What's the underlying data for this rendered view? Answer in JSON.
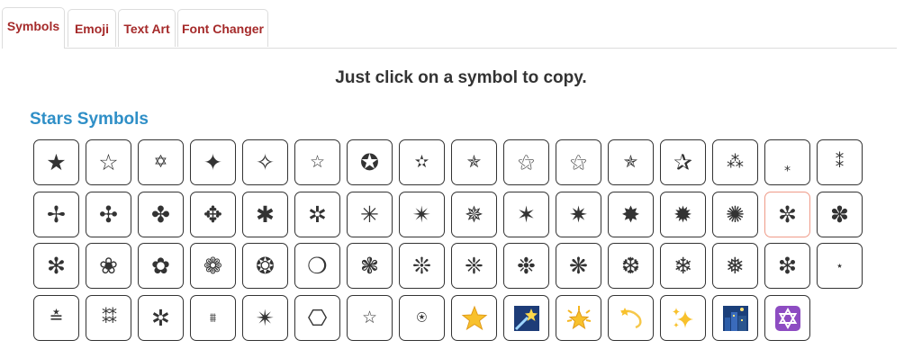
{
  "tabs": [
    {
      "label": "Symbols",
      "active": true
    },
    {
      "label": "Emoji",
      "active": false
    },
    {
      "label": "Text Art",
      "active": false
    },
    {
      "label": "Font Changer",
      "active": false
    }
  ],
  "subtitle": "Just click on a symbol to copy.",
  "section": {
    "title": "Stars Symbols",
    "title_color": "#2f8fc7",
    "selected_symbol": "✼",
    "selected_border_color": "#ef9a88",
    "rows": [
      [
        "★",
        "☆",
        "✡",
        "✦",
        "✧",
        "☆",
        "✪",
        "✫",
        "✯",
        "⚝",
        "⚝",
        "✯",
        "✰",
        "⁂",
        "⁎",
        "⁑"
      ],
      [
        "✢",
        "✣",
        "✤",
        "✥",
        "✱",
        "✲",
        "✳",
        "✴",
        "✵",
        "✶",
        "✷",
        "✸",
        "✹",
        "✺",
        "✼",
        "✽"
      ],
      [
        "✻",
        "❀",
        "✿",
        "❁",
        "❂",
        "❍",
        "❃",
        "❊",
        "❈",
        "❉",
        "❋",
        "❆",
        "❄",
        "❅",
        "❇",
        "⋆"
      ],
      [
        "≛",
        "⁑⁑",
        "✲",
        "⩩",
        "✴",
        "⎔",
        "☆",
        "⍟",
        "⭐",
        "🌠",
        "🌟",
        "💫",
        "✨",
        "🌃",
        "🔯"
      ]
    ]
  }
}
